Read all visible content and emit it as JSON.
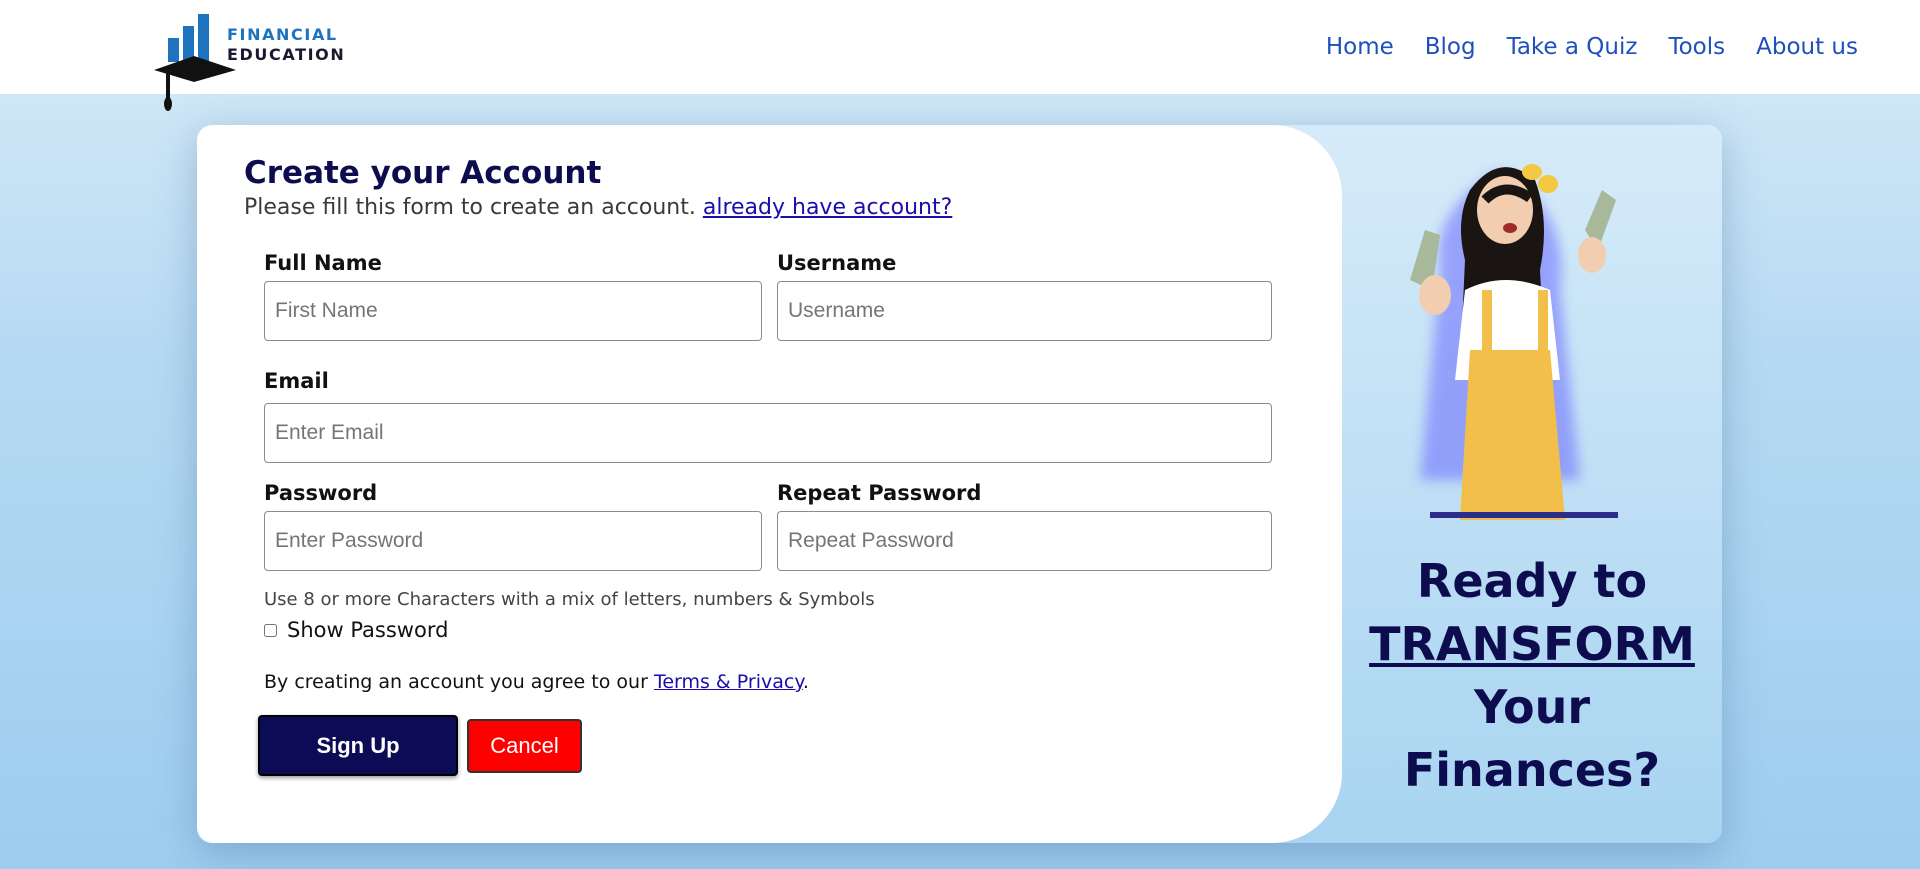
{
  "brand": {
    "line1": "FINANCIAL",
    "line2": "EDUCATION"
  },
  "nav": {
    "items": [
      {
        "label": "Home"
      },
      {
        "label": "Blog"
      },
      {
        "label": "Take a Quiz"
      },
      {
        "label": "Tools"
      },
      {
        "label": "About us"
      }
    ]
  },
  "form": {
    "title": "Create your Account",
    "subtitle": "Please fill this form to create an account.",
    "login_link": "already have account?",
    "full_name_label": "Full Name",
    "full_name_placeholder": "First Name",
    "username_label": "Username",
    "username_placeholder": "Username",
    "email_label": "Email",
    "email_placeholder": "Enter Email",
    "password_label": "Password",
    "password_placeholder": "Enter Password",
    "repeat_password_label": "Repeat Password",
    "repeat_password_placeholder": "Repeat Password",
    "password_hint": "Use 8 or more Characters with a mix of letters, numbers & Symbols",
    "show_password_label": "Show Password",
    "show_password_checked": false,
    "terms_prefix": "By creating an account you agree to our",
    "terms_link": "Terms & Privacy",
    "terms_suffix": ".",
    "signup_label": "Sign Up",
    "cancel_label": "Cancel"
  },
  "promo": {
    "line1": "Ready to",
    "line2": "TRANSFORM",
    "line3": "Your",
    "line4": "Finances?"
  },
  "colors": {
    "navy": "#0c0c4f",
    "link_blue": "#1e4fbf",
    "cancel_red": "#ff0000",
    "brand_blue": "#1e73be"
  }
}
